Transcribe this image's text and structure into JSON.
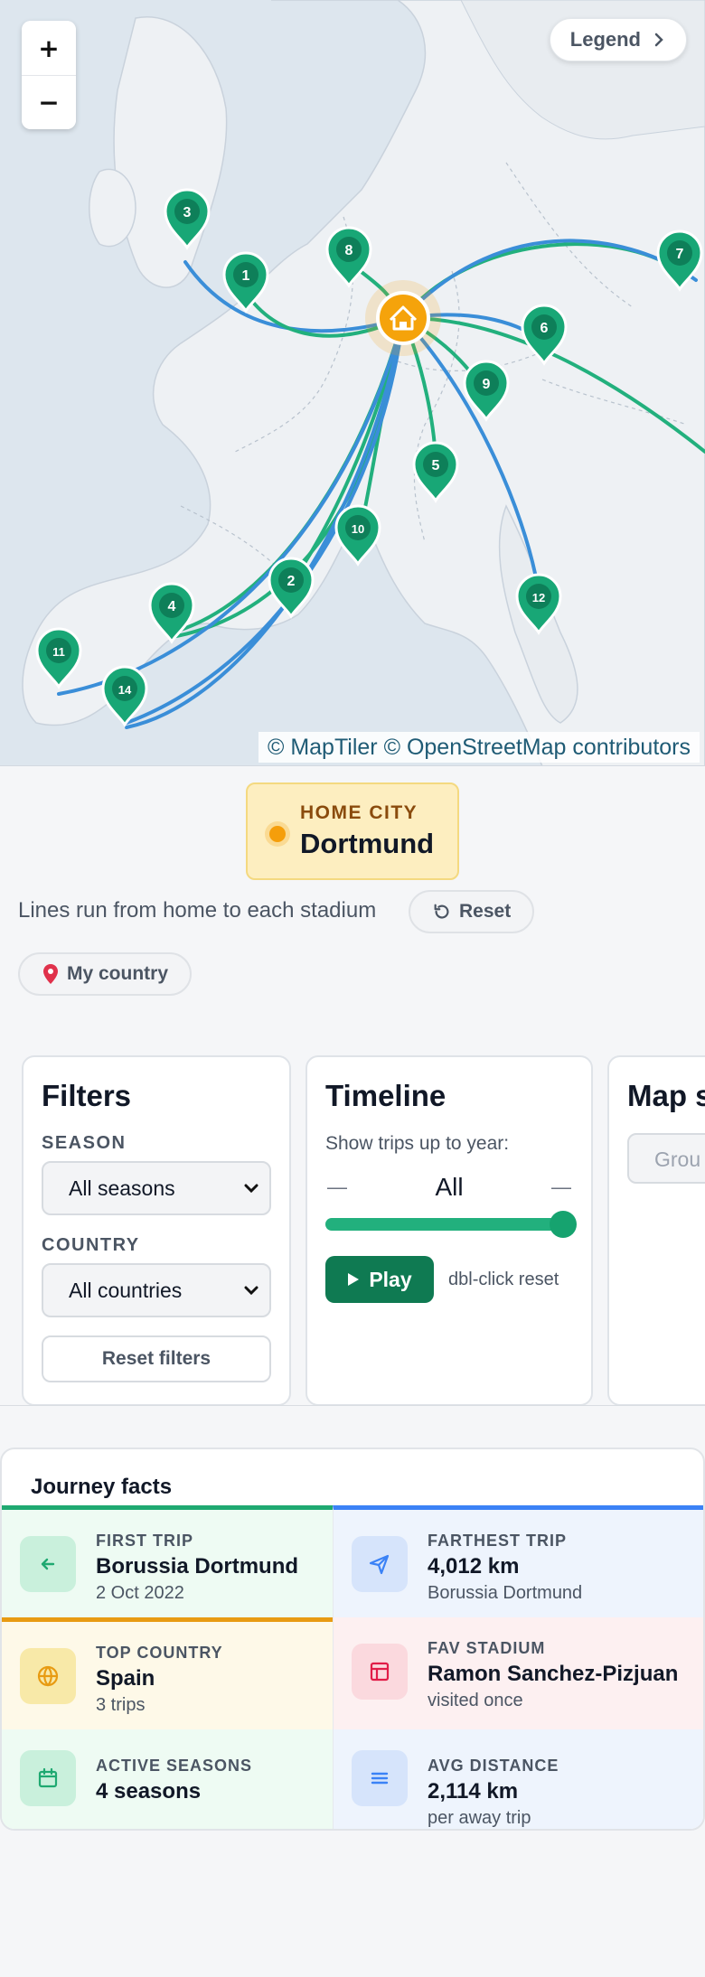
{
  "map": {
    "zoom_in": "+",
    "zoom_out": "−",
    "legend_label": "Legend",
    "attribution": "© MapTiler © OpenStreetMap contributors",
    "markers": [
      "1",
      "2",
      "3",
      "4",
      "5",
      "6",
      "7",
      "8",
      "9",
      "10",
      "11",
      "12",
      "14"
    ]
  },
  "home": {
    "label": "HOME CITY",
    "city": "Dortmund"
  },
  "controls": {
    "lines_text": "Lines run from home to each stadium",
    "reset_label": "Reset",
    "my_country_label": "My country"
  },
  "filters": {
    "title": "Filters",
    "season_label": "SEASON",
    "season_value": "All seasons",
    "country_label": "COUNTRY",
    "country_value": "All countries",
    "reset_label": "Reset filters"
  },
  "timeline": {
    "title": "Timeline",
    "show_text": "Show trips up to year:",
    "min_label": "—",
    "value_label": "All",
    "max_label": "—",
    "slider_fraction": 1.0,
    "play_label": "Play",
    "hint": "dbl-click reset"
  },
  "map_panel": {
    "title": "Map s",
    "option": "Grou"
  },
  "facts": {
    "title": "Journey facts",
    "items": [
      {
        "label": "FIRST TRIP",
        "value": "Borussia Dortmund",
        "sub": "2 Oct 2022",
        "icon": "arrow-left-icon",
        "color": "#1fa971"
      },
      {
        "label": "FARTHEST TRIP",
        "value": "4,012 km",
        "sub": "Borussia Dortmund",
        "icon": "send-icon",
        "color": "#3b82f6"
      },
      {
        "label": "TOP COUNTRY",
        "value": "Spain",
        "sub": "3 trips",
        "icon": "globe-icon",
        "color": "#e89b12"
      },
      {
        "label": "FAV STADIUM",
        "value": "Ramon Sanchez-Pizjuan",
        "sub": "visited once",
        "icon": "stadium-icon",
        "color": "#e11d48"
      },
      {
        "label": "ACTIVE SEASONS",
        "value": "4 seasons",
        "sub": "",
        "icon": "calendar-icon",
        "color": "#1fa971"
      },
      {
        "label": "AVG DISTANCE",
        "value": "2,114 km",
        "sub": "per away trip",
        "icon": "menu-icon",
        "color": "#3b82f6"
      }
    ]
  }
}
